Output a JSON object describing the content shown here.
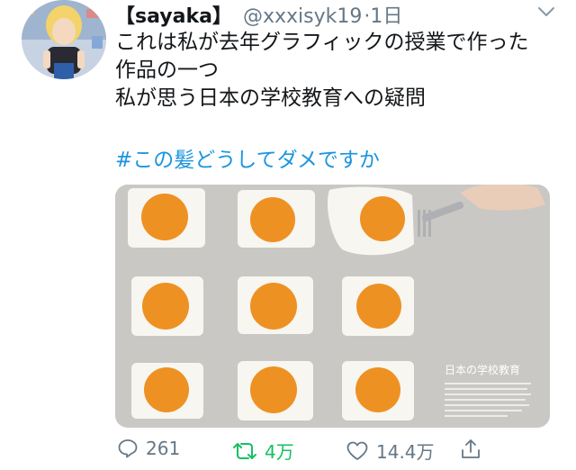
{
  "tweet": {
    "display_name": "【sayaka】",
    "handle": "@xxxisyk19",
    "time": "·1日",
    "lines": [
      "これは私が去年グラフィックの授業で作った",
      "作品の一つ",
      "私が思う日本の学校教育への疑問"
    ],
    "hashtag": "#この髪どうしてダメですか"
  },
  "media": {
    "poster_title": "日本の学校教育"
  },
  "actions": {
    "reply_count": "261",
    "retweet_count": "4万",
    "like_count": "14.4万"
  },
  "colors": {
    "link": "#1b95e0",
    "retweet": "#17bf63",
    "icon": "#657786"
  }
}
